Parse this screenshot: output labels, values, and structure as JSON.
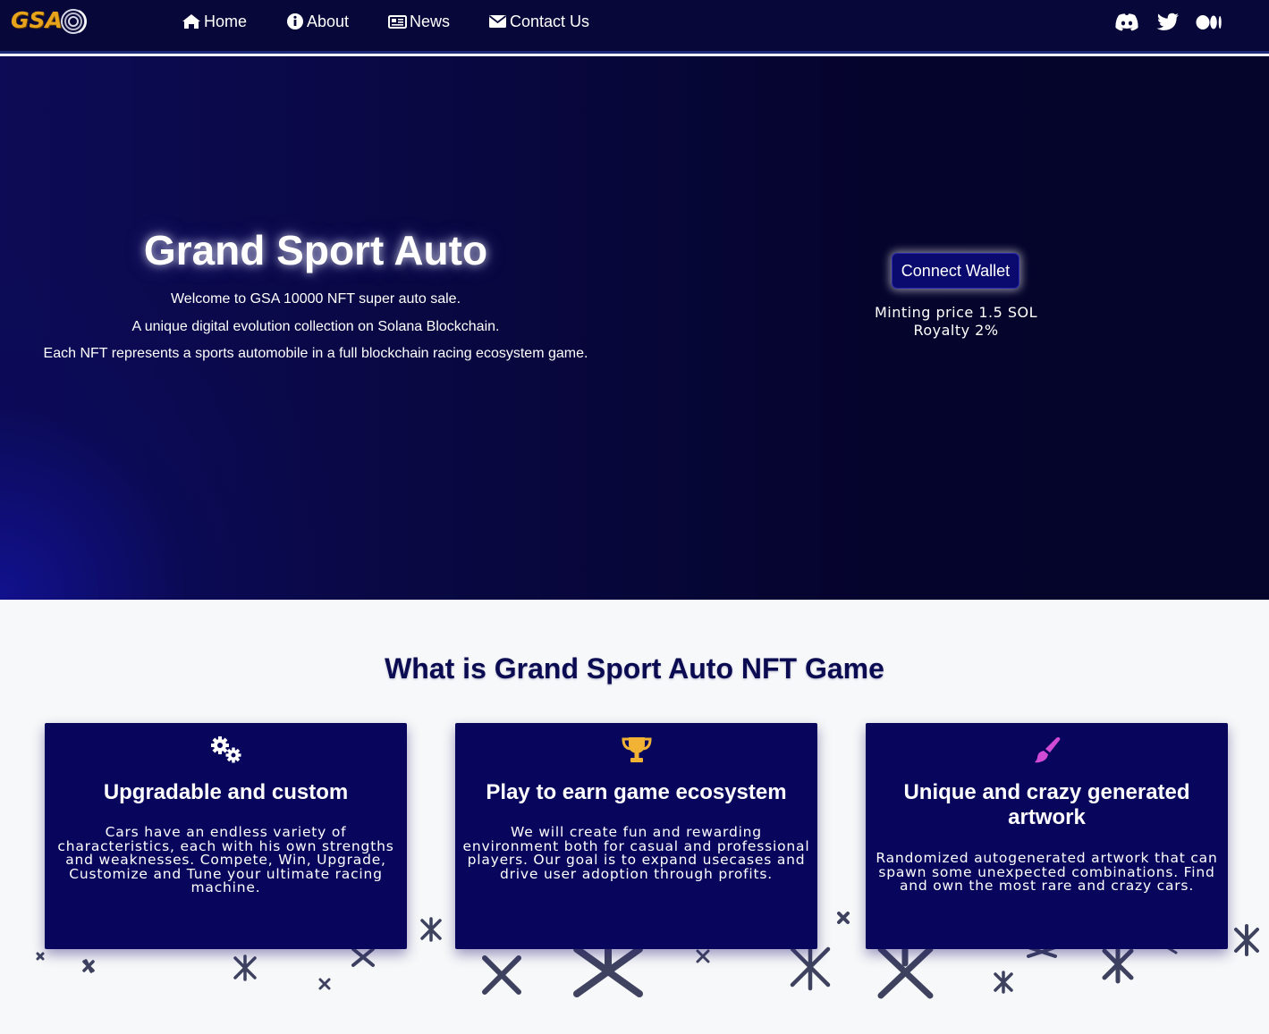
{
  "nav": {
    "logo_text": "GSA",
    "links": [
      {
        "label": "Home",
        "icon": "home-icon"
      },
      {
        "label": "About",
        "icon": "info-icon"
      },
      {
        "label": "News",
        "icon": "newspaper-icon"
      },
      {
        "label": "Contact Us",
        "icon": "envelope-icon"
      }
    ],
    "social": [
      "discord-icon",
      "twitter-icon",
      "medium-icon"
    ]
  },
  "hero": {
    "title": "Grand Sport Auto",
    "lines": [
      "Welcome to GSA 10000 NFT super auto sale.",
      "A unique digital evolution collection on Solana Blockchain.",
      "Each NFT represents a sports automobile in a full blockchain racing ecosystem game."
    ],
    "connect_label": "Connect Wallet",
    "minting_price": "Minting price 1.5 SOL",
    "royalty": "Royalty 2%"
  },
  "section": {
    "title": "What is Grand Sport Auto NFT Game",
    "cards": [
      {
        "icon": "gears-icon",
        "title": "Upgradable and custom",
        "text": "Cars have an endless variety of characteristics, each with his own strengths and weaknesses. Compete, Win, Upgrade, Customize and Tune your ultimate racing machine."
      },
      {
        "icon": "trophy-icon",
        "title": "Play to earn game ecosystem",
        "text": "We will create fun and rewarding environment both for casual and professional players. Our goal is to expand usecases and drive user adoption through profits."
      },
      {
        "icon": "paintbrush-icon",
        "title": "Unique and crazy generated artwork",
        "text": "Randomized autogenerated artwork that can spawn some unexpected combinations. Find and own the most rare and crazy cars."
      }
    ]
  },
  "colors": {
    "nav_bg": "#07073a",
    "card_bg": "#08055c",
    "logo_gold": "#e7a31b",
    "trophy_gold": "#f2b233",
    "brush_pink": "#d04ad6"
  }
}
